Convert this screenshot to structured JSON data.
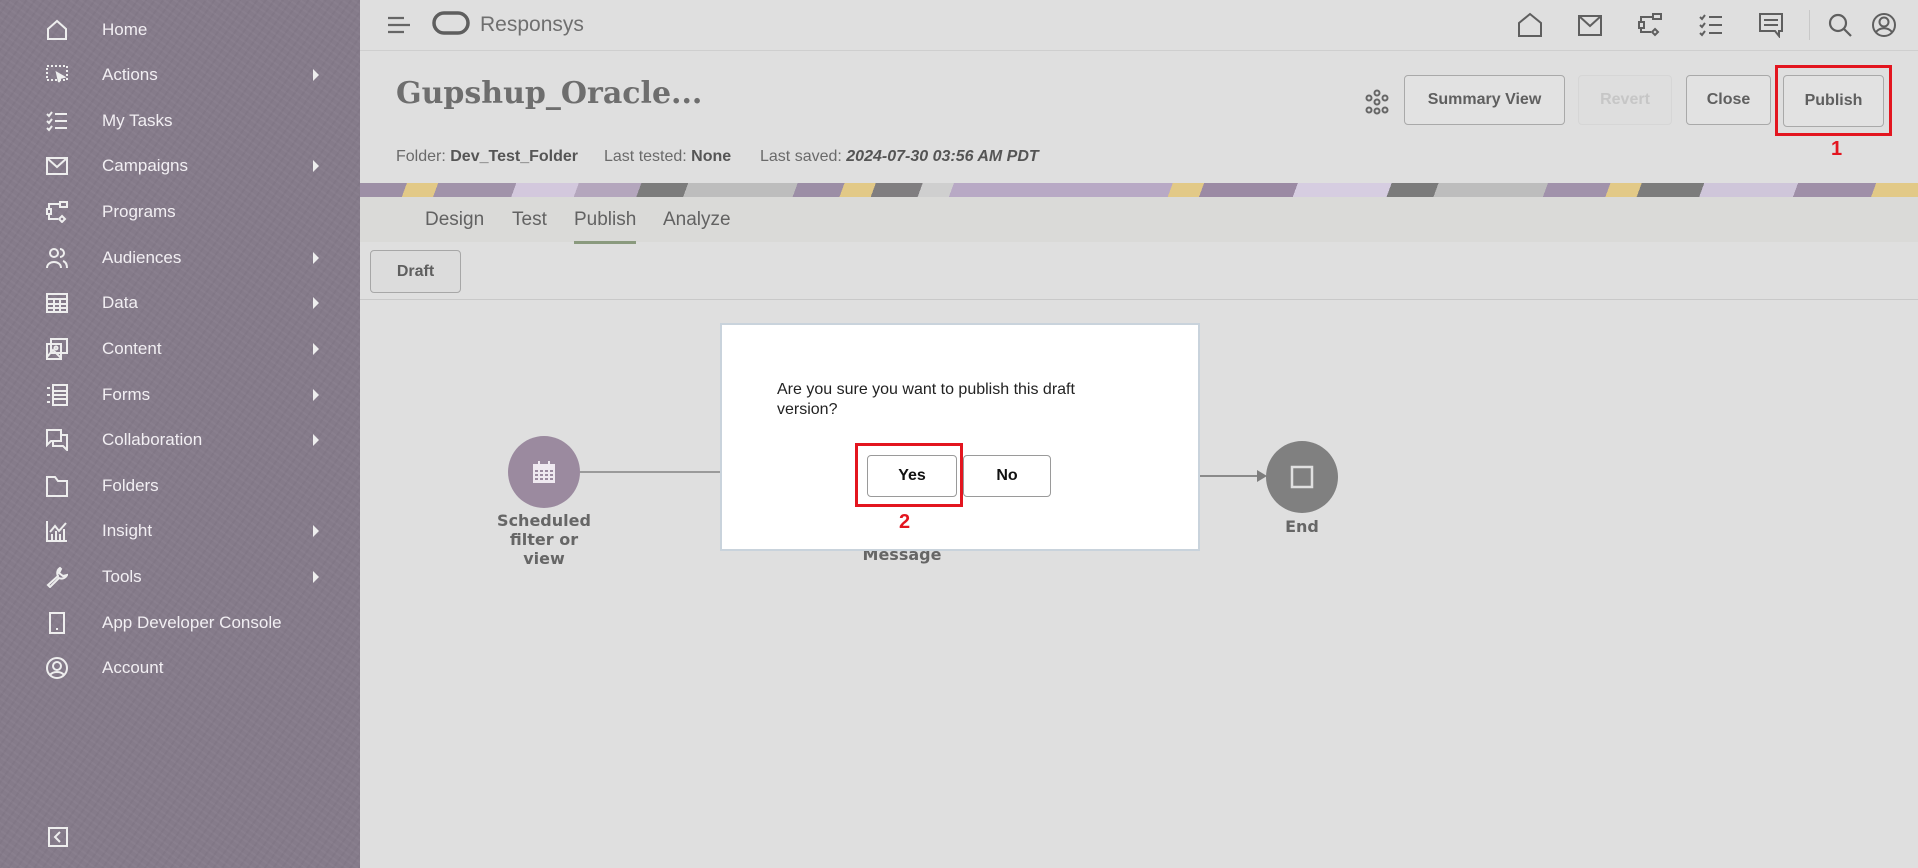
{
  "sidebar": {
    "items": [
      {
        "label": "Home",
        "icon": "home-icon",
        "has_submenu": false
      },
      {
        "label": "Actions",
        "icon": "actions-icon",
        "has_submenu": true
      },
      {
        "label": "My Tasks",
        "icon": "tasks-icon",
        "has_submenu": false
      },
      {
        "label": "Campaigns",
        "icon": "mail-icon",
        "has_submenu": true
      },
      {
        "label": "Programs",
        "icon": "programs-icon",
        "has_submenu": false
      },
      {
        "label": "Audiences",
        "icon": "audiences-icon",
        "has_submenu": true
      },
      {
        "label": "Data",
        "icon": "data-table-icon",
        "has_submenu": true
      },
      {
        "label": "Content",
        "icon": "content-image-icon",
        "has_submenu": true
      },
      {
        "label": "Forms",
        "icon": "forms-icon",
        "has_submenu": true
      },
      {
        "label": "Collaboration",
        "icon": "chat-icon",
        "has_submenu": true
      },
      {
        "label": "Folders",
        "icon": "folder-icon",
        "has_submenu": false
      },
      {
        "label": "Insight",
        "icon": "insight-chart-icon",
        "has_submenu": true
      },
      {
        "label": "Tools",
        "icon": "wrench-icon",
        "has_submenu": true
      },
      {
        "label": "App Developer Console",
        "icon": "mobile-device-icon",
        "has_submenu": false
      },
      {
        "label": "Account",
        "icon": "user-circle-icon",
        "has_submenu": false
      }
    ],
    "collapse_icon": "collapse-left-icon",
    "background": "#857b8a"
  },
  "topbar": {
    "brand": "Responsys",
    "icons": [
      "home-icon",
      "mail-icon",
      "programs-icon",
      "tasks-icon",
      "messages-icon",
      "search-icon",
      "user-profile-icon"
    ]
  },
  "page": {
    "title": "Gupshup_Oracle...",
    "meta": {
      "folder_label": "Folder:",
      "folder_value": "Dev_Test_Folder",
      "tested_label": "Last tested:",
      "tested_value": "None",
      "saved_label": "Last saved:",
      "saved_value": "2024-07-30 03:56 AM PDT"
    },
    "buttons": {
      "summary_view": "Summary View",
      "revert": "Revert",
      "close": "Close",
      "publish": "Publish"
    },
    "tabs": [
      {
        "label": "Design",
        "active": false
      },
      {
        "label": "Test",
        "active": false
      },
      {
        "label": "Publish",
        "active": true
      },
      {
        "label": "Analyze",
        "active": false
      }
    ],
    "version_button": "Draft"
  },
  "canvas": {
    "nodes": [
      {
        "label_lines": [
          "Scheduled",
          "filter or",
          "view"
        ],
        "icon": "calendar-icon",
        "color": "#9b8a9f"
      },
      {
        "label_lines": [
          "Message"
        ],
        "icon": "message-icon",
        "color": "#8a8a8a"
      },
      {
        "label_lines": [
          "End"
        ],
        "icon": "stop-square-icon",
        "color": "#808080"
      }
    ]
  },
  "dialog": {
    "message": "Are you sure you want to publish this draft version?",
    "yes_label": "Yes",
    "no_label": "No"
  },
  "annotations": [
    {
      "number": "1",
      "target": "Publish",
      "color": "#e3151f"
    },
    {
      "number": "2",
      "target": "Yes",
      "color": "#e3151f"
    }
  ]
}
